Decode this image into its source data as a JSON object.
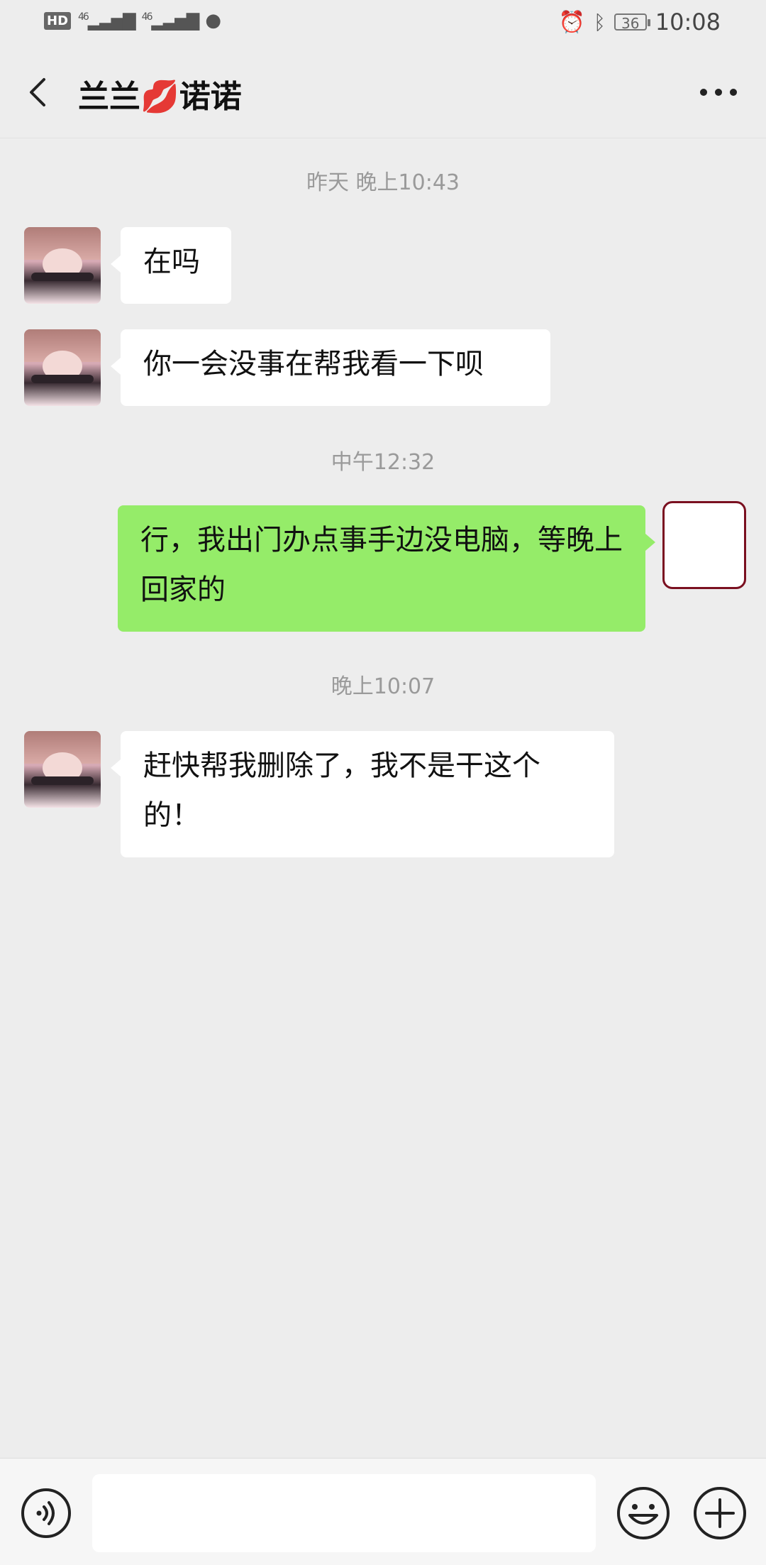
{
  "status_bar": {
    "hd_label": "HD",
    "signal_1": "46",
    "signal_2": "46",
    "battery_level": "36",
    "time": "10:08"
  },
  "header": {
    "title": "兰兰💋诺诺"
  },
  "messages": {
    "ts1": "昨天 晚上10:43",
    "m1": "在吗",
    "m2": "你一会没事在帮我看一下呗",
    "ts2": "中午12:32",
    "m3": "行，我出门办点事手边没电脑，等晚上回家的",
    "ts3": "晚上10:07",
    "m4": "赶快帮我删除了，我不是干这个的！"
  },
  "input_bar": {
    "placeholder": ""
  },
  "icons": {
    "back": "chevron-left-icon",
    "more": "more-dots-icon",
    "voice": "voice-icon",
    "emoji": "emoji-icon",
    "plus": "plus-icon"
  }
}
